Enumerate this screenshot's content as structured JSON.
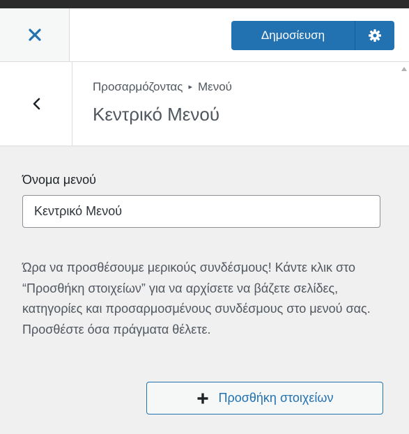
{
  "header": {
    "close_icon": "close-icon",
    "publish_label": "Δημοσίευση",
    "publish_settings_icon": "gear-icon",
    "accent_color": "#2271b1"
  },
  "section": {
    "back_icon": "chevron-left-icon",
    "breadcrumb_parent": "Προσαρμόζοντας",
    "breadcrumb_separator": "▸",
    "breadcrumb_current": "Μενού",
    "title": "Κεντρικό Μενού"
  },
  "form": {
    "menu_name_label": "Όνομα μενού",
    "menu_name_value": "Κεντρικό Μενού",
    "help_text": "Ώρα να προσθέσουμε μερικούς συνδέσμους! Κάντε κλικ στο “Προσθήκη στοιχείων” για να αρχίσετε να βάζετε σελίδες, κατηγορίες και προσαρμοσμένους συνδέσμους στο μενού σας. Προσθέστε όσα πράγματα θέλετε.",
    "add_items_label": "Προσθήκη στοιχείων",
    "add_items_icon": "plus-icon"
  }
}
